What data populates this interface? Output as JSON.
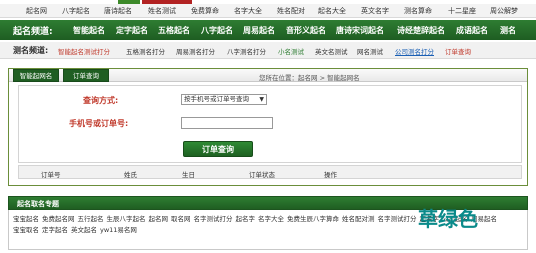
{
  "nav_top": [
    "起名网",
    "八字起名",
    "唐诗起名",
    "姓名测试",
    "免费算命",
    "名字大全",
    "姓名配对",
    "起名大全",
    "英文名字",
    "测名算命",
    "十二星座",
    "周公解梦"
  ],
  "channel": {
    "label": "起名频道:",
    "items": [
      "智能起名",
      "定字起名",
      "五格起名",
      "八字起名",
      "周易起名",
      "音形义起名",
      "唐诗宋词起名",
      "诗经楚辞起名",
      "成语起名",
      "测名"
    ]
  },
  "test_channel": {
    "label": "测名频道:",
    "items": [
      {
        "text": "智能起名测试打分",
        "color": "#c0392b",
        "underline": false
      },
      {
        "text": "五格测名打分",
        "color": "#333333",
        "underline": false
      },
      {
        "text": "周易测名打分",
        "color": "#333333",
        "underline": false
      },
      {
        "text": "八字测名打分",
        "color": "#333333",
        "underline": false
      },
      {
        "text": "小名测试",
        "color": "#2e7d32",
        "underline": false
      },
      {
        "text": "英文名测试",
        "color": "#333333",
        "underline": false
      },
      {
        "text": "网名测试",
        "color": "#333333",
        "underline": false
      },
      {
        "text": "公司测名打分",
        "color": "#1a5fb4",
        "underline": true
      },
      {
        "text": "订单查询",
        "color": "#c0392b",
        "underline": false
      }
    ]
  },
  "panel": {
    "tabs": [
      "智能起网名",
      "订单查询"
    ],
    "breadcrumb": "您所在位置：起名网 > 智能起网名"
  },
  "form": {
    "query_label": "查询方式:",
    "query_select": "按手机号或订单号查询",
    "input_label": "手机号或订单号:",
    "input_value": "",
    "submit": "订单查询"
  },
  "table": {
    "columns": [
      "订单号",
      "姓氏",
      "生日",
      "订单状态",
      "操作"
    ]
  },
  "bottom": {
    "title": "起名取名专题",
    "links": [
      "宝宝起名",
      "免费起名网",
      "五行起名",
      "生辰八字起名",
      "起名网",
      "取名网",
      "名字测试打分",
      "起名字",
      "名字大全",
      "免费生辰八字算命",
      "姓名配对测",
      "名字测试打分",
      "起名字",
      "公司起名",
      "周易起名",
      "宝宝取名",
      "定字起名",
      "英文起名",
      "yw11易名网"
    ]
  },
  "watermark": "草绿色",
  "colors": {
    "brand_green": "#2e7d32",
    "accent_red": "#c0392b",
    "link_blue": "#1a5fb4",
    "watermark_teal": "#0a8a8a"
  }
}
